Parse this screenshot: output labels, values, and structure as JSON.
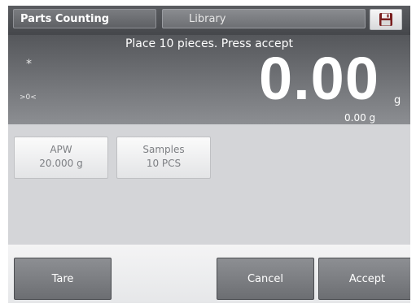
{
  "header": {
    "app_title": "Parts Counting",
    "library_label": "Library",
    "save_icon": "save-icon"
  },
  "readout": {
    "prompt": "Place 10 pieces.  Press accept",
    "stable_indicator": "*",
    "zero_indicator": ">0<",
    "main_value": "0.00",
    "main_unit": "g",
    "secondary_value": "0.00 g"
  },
  "params": [
    {
      "label": "APW",
      "value": "20.000 g"
    },
    {
      "label": "Samples",
      "value": "10 PCS"
    }
  ],
  "footer": {
    "tare_label": "Tare",
    "cancel_label": "Cancel",
    "accept_label": "Accept"
  },
  "colors": {
    "header_bg": "#4f5155",
    "readout_bg": "#6b6d71",
    "content_bg": "#d4d5d8",
    "button_bg": "#7c7e82"
  }
}
